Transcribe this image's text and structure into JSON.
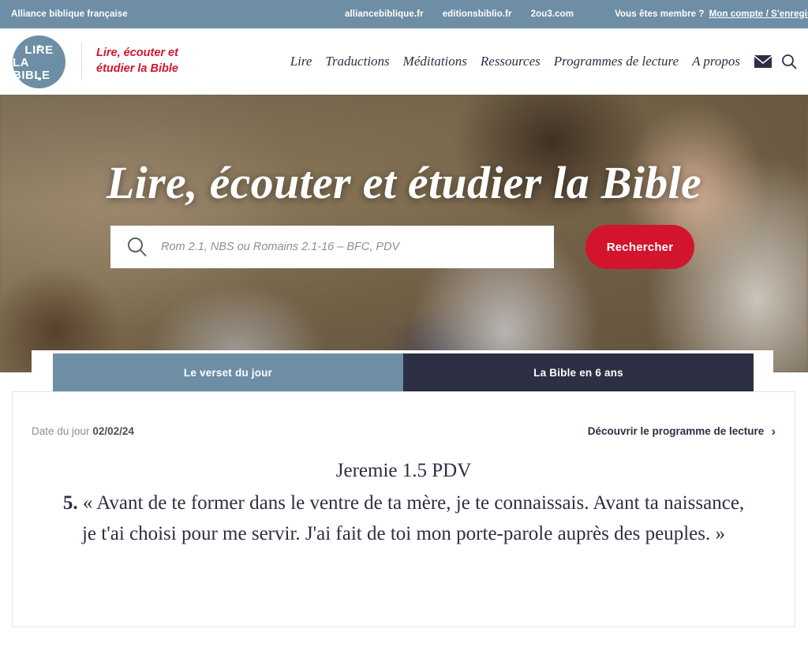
{
  "topbar": {
    "brand": "Alliance biblique française",
    "links": [
      {
        "label": "alliancebiblique.fr"
      },
      {
        "label": "editionsbiblio.fr"
      },
      {
        "label": "2ou3.com"
      }
    ],
    "member_question": "Vous êtes membre ?",
    "account_link": "Mon compte / S'enregistrer"
  },
  "header": {
    "logo_line1": "LIRE",
    "logo_line2": "LA BIBLE",
    "tagline": "Lire, écouter et\nétudier la Bible",
    "nav": [
      {
        "label": "Lire"
      },
      {
        "label": "Traductions"
      },
      {
        "label": "Méditations"
      },
      {
        "label": "Ressources"
      },
      {
        "label": "Programmes de lecture"
      },
      {
        "label": "A propos"
      }
    ],
    "mail_icon": "envelope-icon",
    "search_icon": "search-icon"
  },
  "hero": {
    "title": "Lire, écouter et étudier la Bible",
    "search_placeholder": "Rom 2.1, NBS ou Romains 2.1-16 – BFC, PDV",
    "search_value": "",
    "search_button": "Rechercher",
    "search_icon": "magnifier-icon"
  },
  "tabs": [
    {
      "label": "Le verset du jour",
      "state": "active"
    },
    {
      "label": "La Bible en 6 ans",
      "state": "inactive"
    }
  ],
  "card": {
    "date_label": "Date du jour",
    "date_value": "02/02/24",
    "program_link": "Découvrir le programme de lecture",
    "program_chevron": "›",
    "verse_reference": "Jeremie 1.5 PDV",
    "verse_number": "5.",
    "verse_text": "« Avant de te former dans le ventre de ta mère, je te connaissais. Avant ta naissance, je t'ai choisi pour me servir. J'ai fait de toi mon porte-parole auprès des peuples. »"
  },
  "colors": {
    "accent_red": "#d2152c",
    "brand_blue_grey": "#6d8ea5",
    "dark_navy": "#2d2f44",
    "link_blue": "#1d4e9b"
  }
}
